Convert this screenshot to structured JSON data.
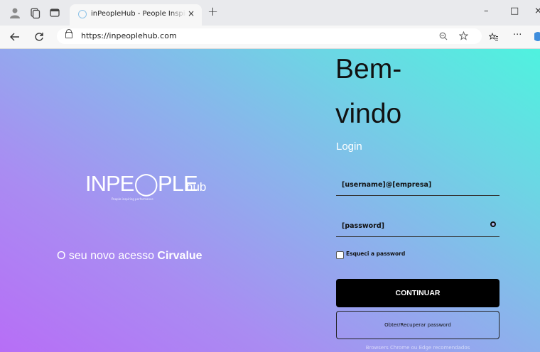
{
  "browser": {
    "tab_title": "inPeopleHub - People Inspiring Pe",
    "tab_close": "×",
    "new_tab": "+",
    "url": "https://inpeoplehub.com",
    "window_minimize": "–",
    "window_maximize": "□",
    "window_close": "×",
    "more_tools": "···"
  },
  "brand": {
    "logo_main": "INPE◯PLE",
    "logo_suffix": "hub",
    "logo_tagline": "People inspiring performance",
    "tagline_prefix": "O seu novo acesso ",
    "tagline_bold": "Cirvalue"
  },
  "login": {
    "welcome_line1": "Bem-",
    "welcome_line2": "vindo",
    "title": "Login",
    "username_placeholder": "[username]@[empresa]",
    "password_placeholder": "[password]",
    "remember_label": "Esqueci a password",
    "continue_label": "CONTINUAR",
    "recover_label": "Obter/Recuperar password",
    "browsers_note": "Browsers Chrome ou Edge recomendados"
  },
  "icons": {
    "profile": "profile-icon",
    "collections": "collections-icon",
    "tab_actions": "tab-actions-icon",
    "back": "back-arrow-icon",
    "refresh": "refresh-icon",
    "lock": "lock-icon",
    "zoom": "zoom-icon",
    "favorite": "star-icon",
    "favorites_bar": "favorites-icon",
    "eye": "eye-icon"
  },
  "colors": {
    "gradient_start": "#b76ef6",
    "gradient_end": "#4ff2df",
    "button_bg": "#000000"
  }
}
